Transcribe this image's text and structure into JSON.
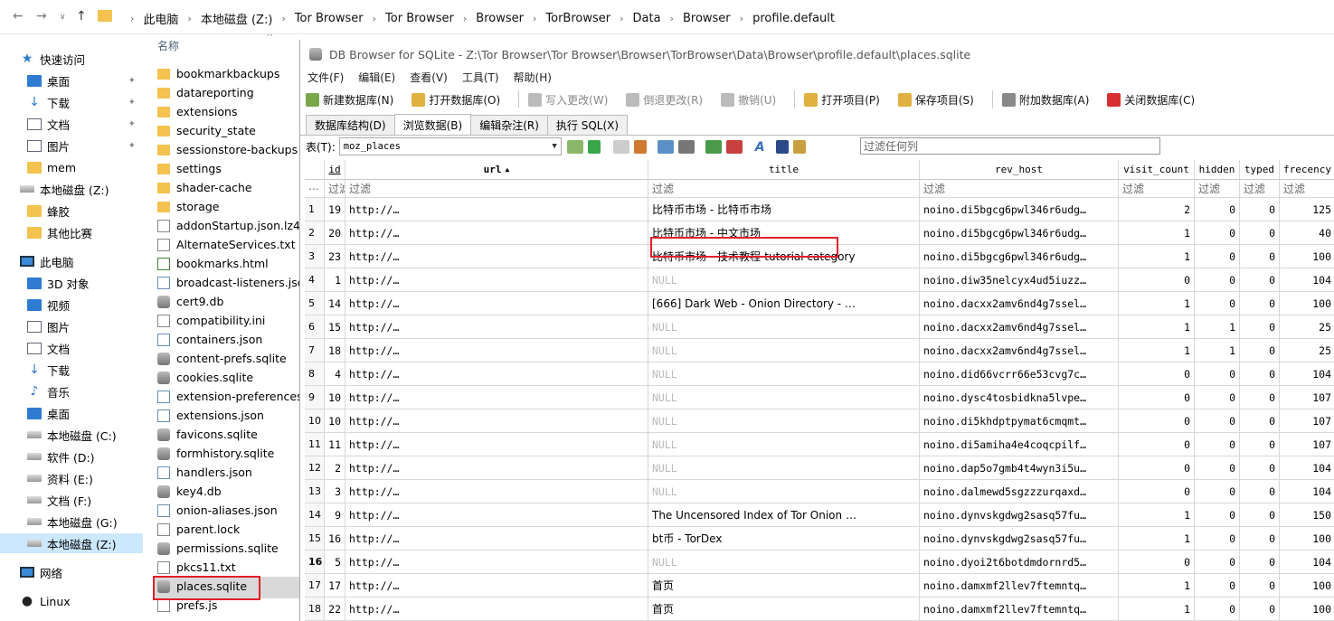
{
  "address": {
    "crumbs": [
      "此电脑",
      "本地磁盘 (Z:)",
      "Tor Browser",
      "Tor Browser",
      "Browser",
      "TorBrowser",
      "Data",
      "Browser",
      "profile.default"
    ]
  },
  "nav_pane": {
    "items": [
      {
        "label": "快速访问",
        "icon": "star-icon",
        "pinned": false
      },
      {
        "label": "桌面",
        "icon": "desktop-icon",
        "pinned": true
      },
      {
        "label": "下载",
        "icon": "download-icon",
        "pinned": true
      },
      {
        "label": "文档",
        "icon": "document-icon",
        "pinned": true
      },
      {
        "label": "图片",
        "icon": "pictures-icon",
        "pinned": true
      },
      {
        "label": "mem",
        "icon": "folder-icon",
        "pinned": false
      },
      {
        "label": "本地磁盘 (Z:)",
        "icon": "drive-icon",
        "pinned": false
      },
      {
        "label": "蜂胶",
        "icon": "folder-icon",
        "pinned": false
      },
      {
        "label": "其他比赛",
        "icon": "folder-icon",
        "pinned": false
      },
      {
        "label": "此电脑",
        "icon": "computer-icon",
        "pinned": false
      },
      {
        "label": "3D 对象",
        "icon": "3d-objects-icon",
        "pinned": false
      },
      {
        "label": "视频",
        "icon": "video-icon",
        "pinned": false
      },
      {
        "label": "图片",
        "icon": "pictures-icon",
        "pinned": false
      },
      {
        "label": "文档",
        "icon": "document-icon",
        "pinned": false
      },
      {
        "label": "下载",
        "icon": "download-icon",
        "pinned": false
      },
      {
        "label": "音乐",
        "icon": "music-icon",
        "pinned": false
      },
      {
        "label": "桌面",
        "icon": "desktop-icon",
        "pinned": false
      },
      {
        "label": "本地磁盘 (C:)",
        "icon": "drive-icon",
        "pinned": false
      },
      {
        "label": "软件 (D:)",
        "icon": "drive-icon",
        "pinned": false
      },
      {
        "label": "资料 (E:)",
        "icon": "drive-icon",
        "pinned": false
      },
      {
        "label": "文档 (F:)",
        "icon": "drive-icon",
        "pinned": false
      },
      {
        "label": "本地磁盘 (G:)",
        "icon": "drive-icon",
        "pinned": false
      },
      {
        "label": "本地磁盘 (Z:)",
        "icon": "drive-icon",
        "pinned": false,
        "selected": true
      },
      {
        "label": "网络",
        "icon": "network-icon",
        "pinned": false
      },
      {
        "label": "Linux",
        "icon": "linux-icon",
        "pinned": false
      }
    ]
  },
  "file_list": {
    "header": "名称",
    "items": [
      {
        "name": "bookmarkbackups",
        "type": "folder"
      },
      {
        "name": "datareporting",
        "type": "folder"
      },
      {
        "name": "extensions",
        "type": "folder"
      },
      {
        "name": "security_state",
        "type": "folder"
      },
      {
        "name": "sessionstore-backups",
        "type": "folder"
      },
      {
        "name": "settings",
        "type": "folder"
      },
      {
        "name": "shader-cache",
        "type": "folder"
      },
      {
        "name": "storage",
        "type": "folder"
      },
      {
        "name": "addonStartup.json.lz4",
        "type": "txt"
      },
      {
        "name": "AlternateServices.txt",
        "type": "txt"
      },
      {
        "name": "bookmarks.html",
        "type": "html"
      },
      {
        "name": "broadcast-listeners.json",
        "type": "json"
      },
      {
        "name": "cert9.db",
        "type": "db"
      },
      {
        "name": "compatibility.ini",
        "type": "txt"
      },
      {
        "name": "containers.json",
        "type": "json"
      },
      {
        "name": "content-prefs.sqlite",
        "type": "db"
      },
      {
        "name": "cookies.sqlite",
        "type": "db"
      },
      {
        "name": "extension-preferences.json",
        "type": "json"
      },
      {
        "name": "extensions.json",
        "type": "json"
      },
      {
        "name": "favicons.sqlite",
        "type": "db"
      },
      {
        "name": "formhistory.sqlite",
        "type": "db"
      },
      {
        "name": "handlers.json",
        "type": "json"
      },
      {
        "name": "key4.db",
        "type": "db"
      },
      {
        "name": "onion-aliases.json",
        "type": "json"
      },
      {
        "name": "parent.lock",
        "type": "txt"
      },
      {
        "name": "permissions.sqlite",
        "type": "db"
      },
      {
        "name": "pkcs11.txt",
        "type": "txt"
      },
      {
        "name": "places.sqlite",
        "type": "db",
        "selected": true
      },
      {
        "name": "prefs.js",
        "type": "txt"
      }
    ]
  },
  "dbbrowser": {
    "title": "DB Browser for SQLite - Z:\\Tor Browser\\Tor Browser\\Browser\\TorBrowser\\Data\\Browser\\profile.default\\places.sqlite",
    "menu": [
      "文件(F)",
      "编辑(E)",
      "查看(V)",
      "工具(T)",
      "帮助(H)"
    ],
    "toolbar": [
      {
        "label": "新建数据库(N)",
        "enabled": true,
        "color": "#7aa64a"
      },
      {
        "label": "打开数据库(O)",
        "enabled": true,
        "color": "#e0b040"
      },
      {
        "label": "写入更改(W)",
        "enabled": false,
        "color": "#bbbbbb"
      },
      {
        "label": "倒退更改(R)",
        "enabled": false,
        "color": "#bbbbbb"
      },
      {
        "label": "撤销(U)",
        "enabled": false,
        "color": "#bbbbbb"
      },
      {
        "label": "打开项目(P)",
        "enabled": true,
        "color": "#e0b040"
      },
      {
        "label": "保存项目(S)",
        "enabled": true,
        "color": "#e0b040"
      },
      {
        "label": "附加数据库(A)",
        "enabled": true,
        "color": "#888888"
      },
      {
        "label": "关闭数据库(C)",
        "enabled": true,
        "color": "#d83030"
      }
    ],
    "tabs": [
      "数据库结构(D)",
      "浏览数据(B)",
      "编辑杂注(R)",
      "执行 SQL(X)"
    ],
    "active_tab": 1,
    "table_label": "表(T):",
    "table_name": "moz_places",
    "filter_placeholder": "过滤任何列",
    "columns": [
      "id",
      "url",
      "title",
      "rev_host",
      "visit_count",
      "hidden",
      "typed",
      "frecency"
    ],
    "filter_text": "过滤",
    "rows": [
      {
        "rn": "1",
        "id": "19",
        "url": "http://…",
        "title": "比特币市场 - 比特币市场",
        "rev_host": "noino.di5bgcg6pwl346r6udg…",
        "visit_count": "2",
        "hidden": "0",
        "typed": "0",
        "frecency": "125"
      },
      {
        "rn": "2",
        "id": "20",
        "url": "http://…",
        "title": "比特币市场 - 中文市场",
        "rev_host": "noino.di5bgcg6pwl346r6udg…",
        "visit_count": "1",
        "hidden": "0",
        "typed": "0",
        "frecency": "40"
      },
      {
        "rn": "3",
        "id": "23",
        "url": "http://…",
        "title": "比特币市场 - 技术教程-tutorial category",
        "rev_host": "noino.di5bgcg6pwl346r6udg…",
        "visit_count": "1",
        "hidden": "0",
        "typed": "0",
        "frecency": "100"
      },
      {
        "rn": "4",
        "id": "1",
        "url": "http://…",
        "title": "NULL",
        "rev_host": "noino.diw35nelcyx4ud5iuzz…",
        "visit_count": "0",
        "hidden": "0",
        "typed": "0",
        "frecency": "104"
      },
      {
        "rn": "5",
        "id": "14",
        "url": "http://…",
        "title": "[666] Dark Web - Onion Directory - …",
        "rev_host": "noino.dacxx2amv6nd4g7ssel…",
        "visit_count": "1",
        "hidden": "0",
        "typed": "0",
        "frecency": "100"
      },
      {
        "rn": "6",
        "id": "15",
        "url": "http://…",
        "title": "NULL",
        "rev_host": "noino.dacxx2amv6nd4g7ssel…",
        "visit_count": "1",
        "hidden": "1",
        "typed": "0",
        "frecency": "25"
      },
      {
        "rn": "7",
        "id": "18",
        "url": "http://…",
        "title": "NULL",
        "rev_host": "noino.dacxx2amv6nd4g7ssel…",
        "visit_count": "1",
        "hidden": "1",
        "typed": "0",
        "frecency": "25"
      },
      {
        "rn": "8",
        "id": "4",
        "url": "http://…",
        "title": "NULL",
        "rev_host": "noino.did66vcrr66e53cvg7c…",
        "visit_count": "0",
        "hidden": "0",
        "typed": "0",
        "frecency": "104"
      },
      {
        "rn": "9",
        "id": "10",
        "url": "http://…",
        "title": "NULL",
        "rev_host": "noino.dysc4tosbidkna5lvpe…",
        "visit_count": "0",
        "hidden": "0",
        "typed": "0",
        "frecency": "107"
      },
      {
        "rn": "10",
        "id": "10",
        "url": "http://…",
        "title": "NULL",
        "rev_host": "noino.di5khdptpymat6cmqmt…",
        "visit_count": "0",
        "hidden": "0",
        "typed": "0",
        "frecency": "107"
      },
      {
        "rn": "11",
        "id": "11",
        "url": "http://…",
        "title": "NULL",
        "rev_host": "noino.di5amiha4e4coqcpilf…",
        "visit_count": "0",
        "hidden": "0",
        "typed": "0",
        "frecency": "107"
      },
      {
        "rn": "12",
        "id": "2",
        "url": "http://…",
        "title": "NULL",
        "rev_host": "noino.dap5o7gmb4t4wyn3i5u…",
        "visit_count": "0",
        "hidden": "0",
        "typed": "0",
        "frecency": "104"
      },
      {
        "rn": "13",
        "id": "3",
        "url": "http://…",
        "title": "NULL",
        "rev_host": "noino.dalmewd5sgzzzurqaxd…",
        "visit_count": "0",
        "hidden": "0",
        "typed": "0",
        "frecency": "104"
      },
      {
        "rn": "14",
        "id": "9",
        "url": "http://…",
        "title": "The Uncensored Index of Tor Onion …",
        "rev_host": "noino.dynvskgdwg2sasq57fu…",
        "visit_count": "1",
        "hidden": "0",
        "typed": "0",
        "frecency": "150"
      },
      {
        "rn": "15",
        "id": "16",
        "url": "http://…",
        "title": "bt币 - TorDex",
        "rev_host": "noino.dynvskgdwg2sasq57fu…",
        "visit_count": "1",
        "hidden": "0",
        "typed": "0",
        "frecency": "100"
      },
      {
        "rn": "16",
        "id": "5",
        "url": "http://…",
        "title": "NULL",
        "rev_host": "noino.dyoi2t6botdmdornrd5…",
        "visit_count": "0",
        "hidden": "0",
        "typed": "0",
        "frecency": "104"
      },
      {
        "rn": "17",
        "id": "17",
        "url": "http://…",
        "title": "首页",
        "rev_host": "noino.damxmf2llev7ftemntq…",
        "visit_count": "1",
        "hidden": "0",
        "typed": "0",
        "frecency": "100"
      },
      {
        "rn": "18",
        "id": "22",
        "url": "http://…",
        "title": "首页",
        "rev_host": "noino.damxmf2llev7ftemntq…",
        "visit_count": "1",
        "hidden": "0",
        "typed": "0",
        "frecency": "100"
      }
    ]
  },
  "colors": {
    "highlight": "#e0202a",
    "selection": "#cce8ff"
  }
}
